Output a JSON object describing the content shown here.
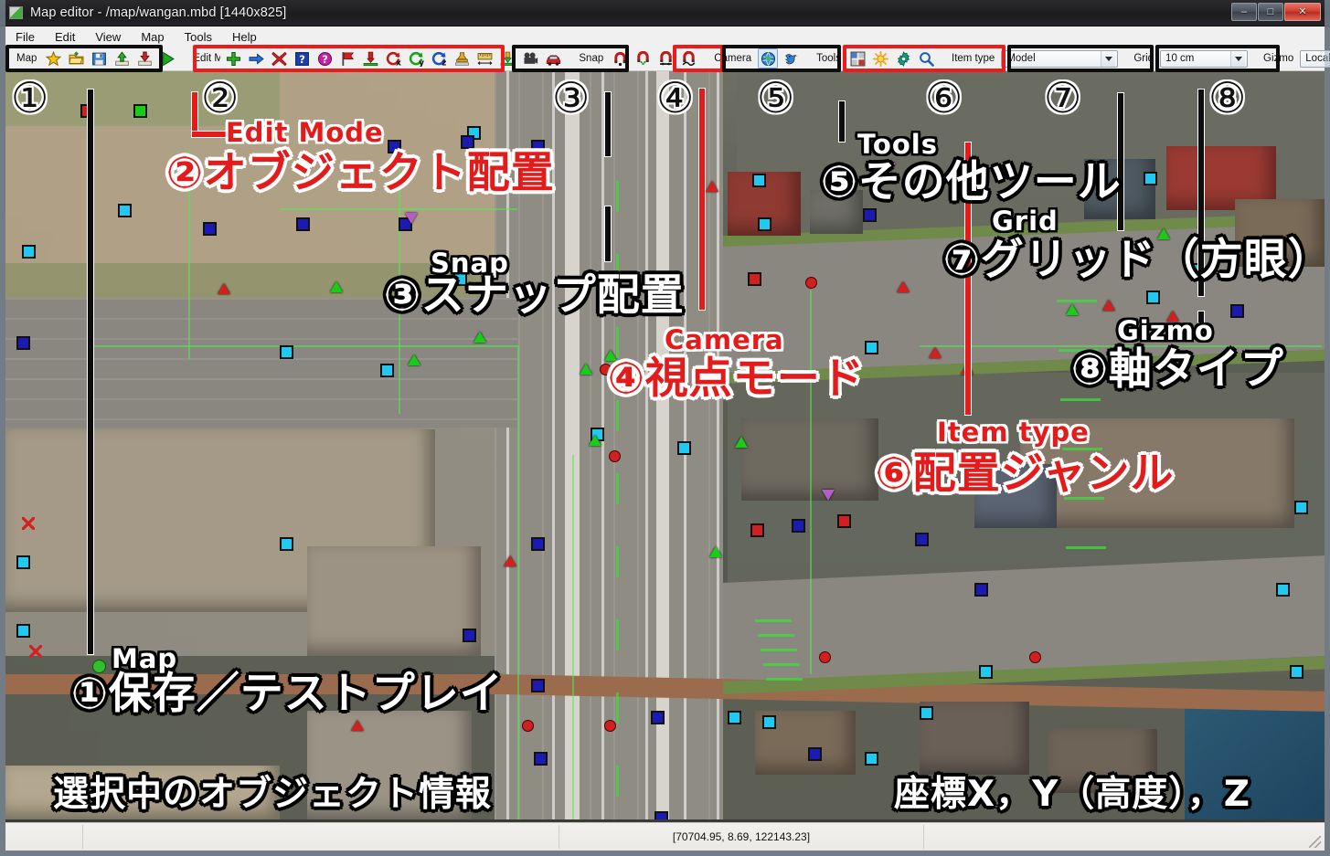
{
  "window": {
    "title": "Map editor - /map/wangan.mbd [1440x825]",
    "icon": "map-editor-icon",
    "controls": {
      "minimize": "–",
      "maximize": "□",
      "close": "✕"
    }
  },
  "menubar": {
    "items": [
      {
        "label": "File",
        "name": "menu-file"
      },
      {
        "label": "Edit",
        "name": "menu-edit"
      },
      {
        "label": "View",
        "name": "menu-view"
      },
      {
        "label": "Map",
        "name": "menu-map"
      },
      {
        "label": "Tools",
        "name": "menu-tools"
      },
      {
        "label": "Help",
        "name": "menu-help"
      }
    ]
  },
  "toolbar": {
    "map_group": {
      "label": "Map",
      "buttons": [
        {
          "name": "new-map-star-icon",
          "title": "New"
        },
        {
          "name": "open-folder-icon",
          "title": "Open"
        },
        {
          "name": "save-floppy-icon",
          "title": "Save"
        },
        {
          "name": "upload-icon",
          "title": "Export"
        },
        {
          "name": "download-icon",
          "title": "Import"
        },
        {
          "name": "play-testplay-icon",
          "title": "Test play"
        }
      ]
    },
    "edit_group": {
      "label": "Edit Mode",
      "buttons": [
        {
          "name": "add-object-plus-icon",
          "title": "Add"
        },
        {
          "name": "move-arrow-icon",
          "title": "Move"
        },
        {
          "name": "delete-cross-icon",
          "title": "Delete"
        },
        {
          "name": "info-blue-question-icon",
          "title": "Info"
        },
        {
          "name": "help-purple-question-icon",
          "title": "Help"
        },
        {
          "name": "flag-red-icon",
          "title": "Flag"
        },
        {
          "name": "drop-to-ground-icon",
          "title": "Drop"
        },
        {
          "name": "rotate-x-icon",
          "title": "Rotate X"
        },
        {
          "name": "rotate-y-icon",
          "title": "Rotate Y"
        },
        {
          "name": "rotate-z-icon",
          "title": "Rotate Z"
        },
        {
          "name": "stamp-icon",
          "title": "Stamp"
        },
        {
          "name": "measure-ruler-icon",
          "title": "Measure"
        },
        {
          "name": "height-pin-icon",
          "title": "Height"
        },
        {
          "name": "camera-object-icon",
          "title": "Camera obj"
        },
        {
          "name": "vehicle-car-icon",
          "title": "Vehicle"
        }
      ]
    },
    "snap_group": {
      "label": "Snap",
      "buttons": [
        {
          "name": "snap-magnet-icon",
          "title": "Snap"
        },
        {
          "name": "snap-magnet-add-icon",
          "title": "Snap add"
        },
        {
          "name": "snap-magnet-line-icon",
          "title": "Snap line"
        },
        {
          "name": "snap-magnet-curve-icon",
          "title": "Snap curve"
        }
      ]
    },
    "camera_group": {
      "label": "Camera",
      "buttons": [
        {
          "name": "camera-globe-icon",
          "title": "Orbit view"
        },
        {
          "name": "camera-bird-icon",
          "title": "Fly view"
        }
      ]
    },
    "tools_group": {
      "label": "Tools",
      "buttons": [
        {
          "name": "tools-grid-palette-icon",
          "title": "Palette"
        },
        {
          "name": "tools-sun-light-icon",
          "title": "Lighting"
        },
        {
          "name": "tools-gear-icon",
          "title": "Settings"
        },
        {
          "name": "tools-magnifier-icon",
          "title": "Search"
        }
      ]
    },
    "itemtype_group": {
      "label": "Item type",
      "value": "Model",
      "name": "item-type-select"
    },
    "grid_group": {
      "label": "Grid",
      "value": "10 cm",
      "name": "grid-select"
    },
    "gizmo_group": {
      "label": "Gizmo",
      "value": "Local",
      "name": "gizmo-select"
    }
  },
  "statusbar": {
    "left": "",
    "coords": "[70704.95, 8.69, 122143.23]"
  },
  "annotations": {
    "numbers": [
      {
        "glyph": "①",
        "name": "callout-number-1"
      },
      {
        "glyph": "②",
        "name": "callout-number-2"
      },
      {
        "glyph": "③",
        "name": "callout-number-3"
      },
      {
        "glyph": "④",
        "name": "callout-number-4"
      },
      {
        "glyph": "⑤",
        "name": "callout-number-5"
      },
      {
        "glyph": "⑥",
        "name": "callout-number-6"
      },
      {
        "glyph": "⑦",
        "name": "callout-number-7"
      },
      {
        "glyph": "⑧",
        "name": "callout-number-8"
      }
    ],
    "labels": {
      "edit_mode_en": "Edit Mode",
      "edit_mode_jp": "②オブジェクト配置",
      "snap_en": "Snap",
      "snap_jp": "③スナップ配置",
      "camera_en": "Camera",
      "camera_jp": "④視点モード",
      "tools_en": "Tools",
      "tools_jp": "⑤その他ツール",
      "grid_en": "Grid",
      "grid_jp": "⑦グリッド（方眼）",
      "gizmo_en": "Gizmo",
      "gizmo_jp": "⑧軸タイプ",
      "itemtype_en": "Item type",
      "itemtype_jp": "⑥配置ジャンル",
      "map_en": "Map",
      "map_jp": "①保存／テストプレイ",
      "selected_object_info_jp": "選択中のオブジェクト情報",
      "coords_jp": "座標X，Y（高度），Z"
    }
  },
  "colors": {
    "annotation_red": "#e41b1b",
    "annotation_white": "#ffffff",
    "annotation_black": "#0d0d0d",
    "marker_cyan": "#21c8f0",
    "marker_blue": "#1b1bb4",
    "marker_red": "#d02020",
    "marker_green": "#18cc18",
    "marker_magenta": "#b060c0"
  }
}
